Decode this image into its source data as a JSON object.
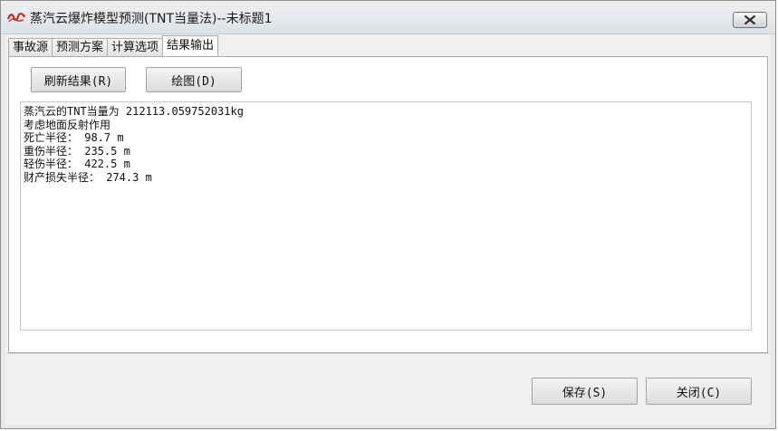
{
  "window": {
    "title": "蒸汽云爆炸模型预测(TNT当量法)--未标题1",
    "icon": "app-logo-icon",
    "close_icon": "close-icon"
  },
  "tabs": [
    {
      "label": "事故源",
      "active": false
    },
    {
      "label": "预测方案",
      "active": false
    },
    {
      "label": "计算选项",
      "active": false
    },
    {
      "label": "结果输出",
      "active": true
    }
  ],
  "toolbar": {
    "refresh_label": "刷新结果(R)",
    "plot_label": "绘图(D)"
  },
  "results": {
    "lines": [
      "蒸汽云的TNT当量为 212113.059752031kg",
      "考虑地面反射作用",
      "死亡半径： 98.7 m",
      "重伤半径： 235.5 m",
      "轻伤半径： 422.5 m",
      "财产损失半径： 274.3 m"
    ]
  },
  "footer": {
    "save_label": "保存(S)",
    "close_label": "关闭(C)"
  },
  "colors": {
    "icon_red": "#c41e1e",
    "window_bg": "#f0f0f0"
  }
}
